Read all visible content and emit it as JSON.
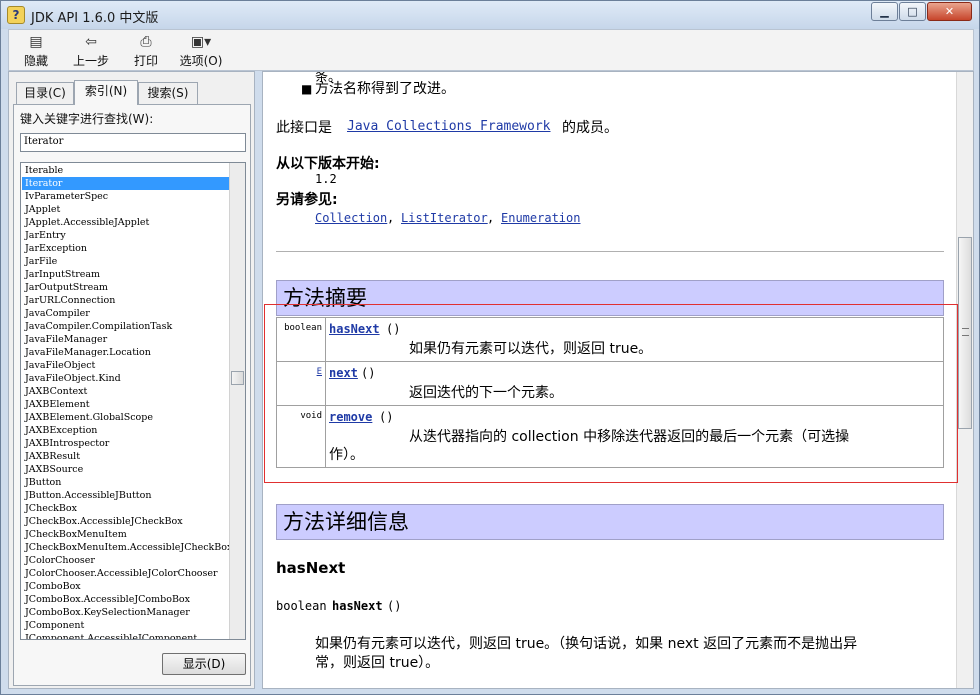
{
  "window": {
    "title": "JDK API 1.6.0 中文版",
    "minimize": "▁",
    "maximize": "□",
    "close": "✕",
    "icon": "help-book-icon"
  },
  "toolbar": {
    "hide": "隐藏",
    "back": "上一步",
    "print": "打印",
    "options": "选项(O)"
  },
  "tabs": {
    "contents": "目录(C)",
    "index": "索引(N)",
    "search": "搜索(S)"
  },
  "index_panel": {
    "label": "键入关键字进行查找(W):",
    "query": "Iterator",
    "display_button": "显示(D)",
    "items": [
      "Iterable",
      "Iterator",
      "IvParameterSpec",
      "JApplet",
      "JApplet.AccessibleJApplet",
      "JarEntry",
      "JarException",
      "JarFile",
      "JarInputStream",
      "JarOutputStream",
      "JarURLConnection",
      "JavaCompiler",
      "JavaCompiler.CompilationTask",
      "JavaFileManager",
      "JavaFileManager.Location",
      "JavaFileObject",
      "JavaFileObject.Kind",
      "JAXBContext",
      "JAXBElement",
      "JAXBElement.GlobalScope",
      "JAXBException",
      "JAXBIntrospector",
      "JAXBResult",
      "JAXBSource",
      "JButton",
      "JButton.AccessibleJButton",
      "JCheckBox",
      "JCheckBox.AccessibleJCheckBox",
      "JCheckBoxMenuItem",
      "JCheckBoxMenuItem.AccessibleJCheckBoxMe",
      "JColorChooser",
      "JColorChooser.AccessibleJColorChooser",
      "JComboBox",
      "JComboBox.AccessibleJComboBox",
      "JComboBox.KeySelectionManager",
      "JComponent",
      "JComponent.AccessibleJComponent"
    ],
    "selected": "Iterator"
  },
  "doc": {
    "top_cut": "条。",
    "bullet": "方法名称得到了改进。",
    "member_prefix": "此接口是",
    "member_link": "Java Collections Framework",
    "member_suffix": "的成员。",
    "since_label": "从以下版本开始:",
    "since_value": "1.2",
    "see_label": "另请参见:",
    "see_links": [
      "Collection",
      "ListIterator",
      "Enumeration"
    ],
    "see_sep": ",",
    "summary_header": "方法摘要",
    "methods": [
      {
        "type": "boolean",
        "name": "hasNext",
        "sig": "()",
        "desc": "如果仍有元素可以迭代，则返回 true。"
      },
      {
        "type": "E",
        "name": "next",
        "sig": "()",
        "desc": "返回迭代的下一个元素。"
      },
      {
        "type": "void",
        "name": "remove",
        "sig": "()",
        "desc": "从迭代器指向的 collection 中移除迭代器返回的最后一个元素（可选操",
        "desc2": "作）。"
      }
    ],
    "detail_header": "方法详细信息",
    "detail_name": "hasNext",
    "detail_sig_type": "boolean",
    "detail_sig_name": "hasNext",
    "detail_sig_parens": "()",
    "detail_desc1": "如果仍有元素可以迭代，则返回 true。（换句话说，如果 next 返回了元素而不是抛出异",
    "detail_desc2": "常，则返回 true）。"
  }
}
